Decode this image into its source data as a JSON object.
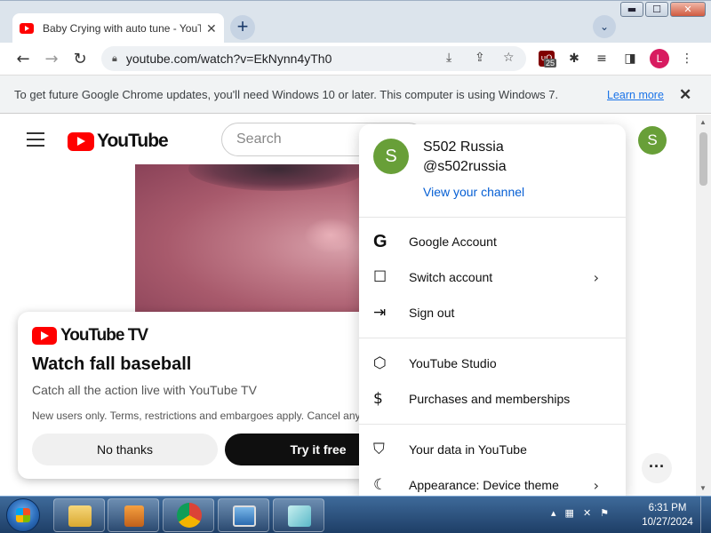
{
  "window": {
    "minimize": "▬",
    "maximize": "☐",
    "close": "✕"
  },
  "tab": {
    "title": "Baby Crying with auto tune - YouTube",
    "close": "✕",
    "new_tab": "+",
    "tab_search": "⌄"
  },
  "toolbar": {
    "back": "←",
    "forward": "→",
    "reload": "↻",
    "url": "youtube.com/watch?v=EkNynn4yTh0",
    "extension_badge": "25",
    "profile_initial": "L"
  },
  "infobar": {
    "message": "To get future Google Chrome updates, you'll need Windows 10 or later. This computer is using Windows 7.",
    "learn_more": "Learn more",
    "close": "✕"
  },
  "youtube": {
    "logo_text": "YouTube",
    "search_placeholder": "Search",
    "avatar_initial": "S"
  },
  "promo": {
    "logo_text": "YouTube TV",
    "title": "Watch fall baseball",
    "subtitle": "Catch all the action live with YouTube TV",
    "fine_print": "New users only. Terms, restrictions and embargoes apply. Cancel anytime.",
    "no_thanks": "No thanks",
    "try_free": "Try it free",
    "more": "···"
  },
  "account_menu": {
    "avatar_initial": "S",
    "name": "S502 Russia",
    "handle": "@s502russia",
    "view_channel": "View your channel",
    "items": [
      {
        "label": "Google Account",
        "icon": "google-icon",
        "glyph": "G",
        "chevron": ""
      },
      {
        "label": "Switch account",
        "icon": "switch-account-icon",
        "glyph": "☐",
        "chevron": "›"
      },
      {
        "label": "Sign out",
        "icon": "sign-out-icon",
        "glyph": "⇥",
        "chevron": ""
      },
      {
        "label": "YouTube Studio",
        "icon": "studio-icon",
        "glyph": "⬡",
        "chevron": ""
      },
      {
        "label": "Purchases and memberships",
        "icon": "dollar-icon",
        "glyph": "$",
        "chevron": ""
      },
      {
        "label": "Your data in YouTube",
        "icon": "shield-icon",
        "glyph": "⛉",
        "chevron": ""
      },
      {
        "label": "Appearance: Device theme",
        "icon": "moon-icon",
        "glyph": "☾",
        "chevron": "›"
      }
    ]
  },
  "taskbar": {
    "time": "6:31 PM",
    "date": "10/27/2024"
  }
}
